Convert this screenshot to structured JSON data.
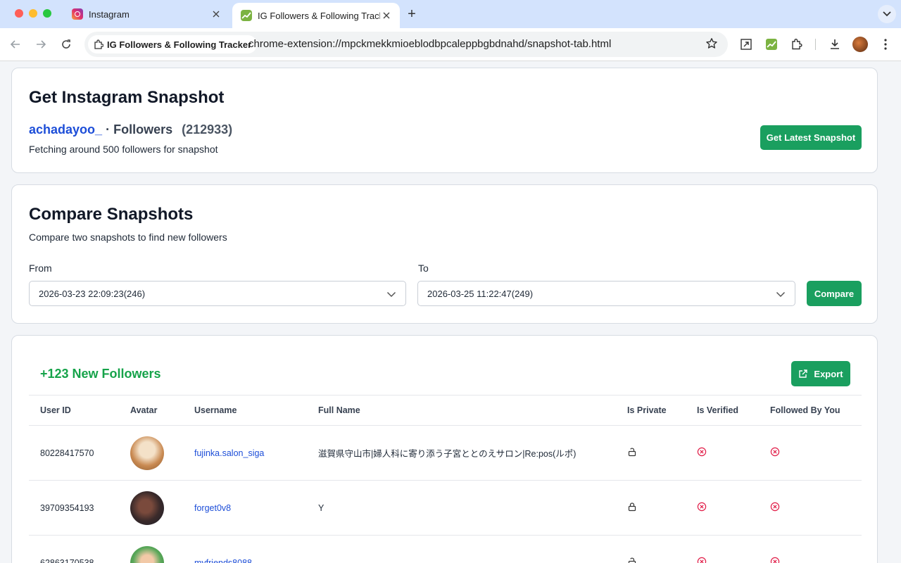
{
  "browser": {
    "tabs": [
      {
        "title": "Instagram",
        "active": false
      },
      {
        "title": "IG Followers & Following Tracker",
        "active": true
      }
    ],
    "extension_chip": "IG Followers & Following Tracker",
    "url": "chrome-extension://mpckmekkmioeblodbpcaleppbgbdnahd/snapshot-tab.html"
  },
  "snapshot": {
    "title": "Get Instagram Snapshot",
    "account": "achadayoo_",
    "separator": "·",
    "section": "Followers",
    "count": "(212933)",
    "status": "Fetching around 500 followers for snapshot",
    "button": "Get Latest Snapshot"
  },
  "compare": {
    "title": "Compare Snapshots",
    "subtitle": "Compare two snapshots to find new followers",
    "from_label": "From",
    "to_label": "To",
    "from_value": "2026-03-23 22:09:23(246)",
    "to_value": "2026-03-25 11:22:47(249)",
    "button": "Compare"
  },
  "results": {
    "heading": "+123 New Followers",
    "export": "Export",
    "columns": [
      "User ID",
      "Avatar",
      "Username",
      "Full Name",
      "Is Private",
      "Is Verified",
      "Followed By You"
    ],
    "rows": [
      {
        "user_id": "80228417570",
        "username": "fujinka.salon_siga",
        "full_name": "滋賀県守山市|婦人科に寄り添う子宮ととのえサロン|Re:pos(ルポ)",
        "is_private": "unlocked-icon",
        "is_verified": "x-circle-icon",
        "followed": "x-circle-icon"
      },
      {
        "user_id": "39709354193",
        "username": "forget0v8",
        "full_name": "Y",
        "is_private": "lock-icon",
        "is_verified": "x-circle-icon",
        "followed": "x-circle-icon"
      },
      {
        "user_id": "62863170538",
        "username": "myfriends8088",
        "full_name": "",
        "is_private": "unlocked-icon",
        "is_verified": "x-circle-icon",
        "followed": "x-circle-icon"
      }
    ]
  },
  "colors": {
    "accent_green": "#1a9f5f",
    "link_blue": "#1d4ed8",
    "new_green": "#16a34a",
    "error_red": "#e11d48"
  }
}
